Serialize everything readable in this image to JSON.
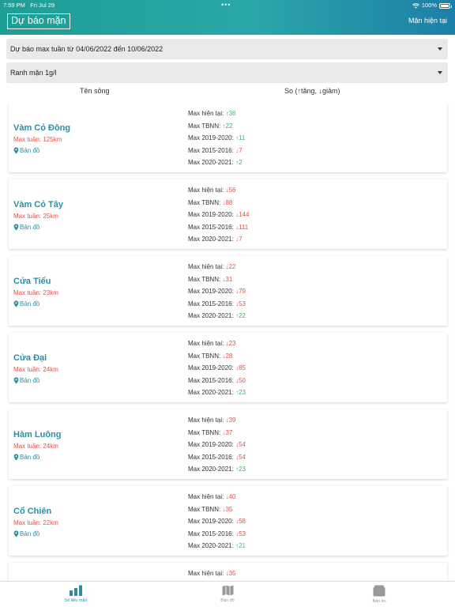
{
  "status_bar": {
    "time": "7:59 PM",
    "date": "Fri Jul 29",
    "battery": "100%"
  },
  "header": {
    "title": "Dự báo mặn",
    "right_link": "Mặn hiện tại"
  },
  "filters": {
    "week": "Dự báo max tuần từ 04/06/2022 đến 10/06/2022",
    "threshold": "Ranh mặn 1g/l"
  },
  "columns": {
    "river": "Tên sông",
    "compare": "So (↑tăng, ↓giảm)"
  },
  "labels": {
    "current": "Max hiện tại:",
    "tbnn": "Max TBNN:",
    "y2019": "Max 2019-2020:",
    "y2015": "Max 2015-2016:",
    "y2020": "Max 2020-2021:",
    "map": "Bản đồ"
  },
  "rivers": [
    {
      "name": "Vàm Cỏ Đông",
      "max_week": "Max tuần: 125km",
      "current": "↑36",
      "tbnn": "↑22",
      "y2019": "↑11",
      "y2015": "↓7",
      "y2020": "↑2"
    },
    {
      "name": "Vàm Cỏ Tây",
      "max_week": "Max tuần: 25km",
      "current": "↓56",
      "tbnn": "↓88",
      "y2019": "↓144",
      "y2015": "↓111",
      "y2020": "↓7"
    },
    {
      "name": "Cửa Tiểu",
      "max_week": "Max tuần: 23km",
      "current": "↓22",
      "tbnn": "↓31",
      "y2019": "↓79",
      "y2015": "↓53",
      "y2020": "↑22"
    },
    {
      "name": "Cửa Đại",
      "max_week": "Max tuần: 24km",
      "current": "↓23",
      "tbnn": "↓28",
      "y2019": "↓85",
      "y2015": "↓50",
      "y2020": "↑23"
    },
    {
      "name": "Hàm Luông",
      "max_week": "Max tuần: 24km",
      "current": "↓39",
      "tbnn": "↓37",
      "y2019": "↓54",
      "y2015": "↓54",
      "y2020": "↑23"
    },
    {
      "name": "Cổ Chiên",
      "max_week": "Max tuần: 22km",
      "current": "↓40",
      "tbnn": "↓35",
      "y2019": "↓58",
      "y2015": "↓53",
      "y2020": "↑21"
    },
    {
      "name": "",
      "max_week": "",
      "current": "↓35",
      "tbnn": "",
      "y2019": "",
      "y2015": "",
      "y2020": ""
    }
  ],
  "tabs": {
    "data": "Số liệu mặn",
    "map": "Bản đồ",
    "news": "Bản tin"
  },
  "colors": {
    "accent": "#2a8fa6",
    "increase": "#3db36c",
    "decrease": "#e0524a"
  }
}
